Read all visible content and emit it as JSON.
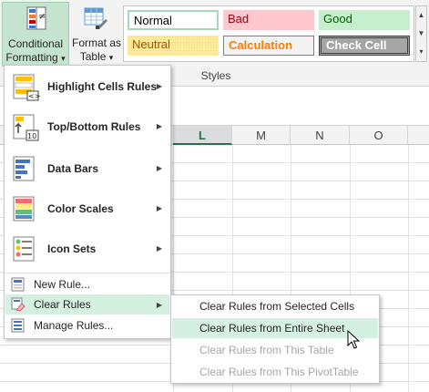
{
  "ribbon": {
    "conditional_formatting": {
      "line1": "Conditional",
      "line2": "Formatting",
      "dropdown_arrow": "▾"
    },
    "format_as_table": {
      "line1": "Format as",
      "line2": "Table",
      "dropdown_arrow": "▾"
    },
    "cell_styles": {
      "normal": "Normal",
      "bad": "Bad",
      "good": "Good",
      "neutral": "Neutral",
      "calculation": "Calculation",
      "check_cell": "Check Cell"
    },
    "styles_group_label": "Styles"
  },
  "sheet": {
    "columns": [
      "L",
      "M",
      "N",
      "O"
    ],
    "active_column": "L"
  },
  "menu": {
    "items": [
      {
        "label": "Highlight Cells Rules",
        "icon": "highlight-cells-rules-icon",
        "submenu": true
      },
      {
        "label": "Top/Bottom Rules",
        "icon": "top-bottom-rules-icon",
        "submenu": true
      },
      {
        "label": "Data Bars",
        "icon": "data-bars-icon",
        "submenu": true
      },
      {
        "label": "Color Scales",
        "icon": "color-scales-icon",
        "submenu": true
      },
      {
        "label": "Icon Sets",
        "icon": "icon-sets-icon",
        "submenu": true
      }
    ],
    "small_items": [
      {
        "label": "New Rule...",
        "icon": "new-rule-icon"
      },
      {
        "label": "Clear Rules",
        "icon": "clear-rules-icon",
        "submenu": true,
        "highlighted": true
      },
      {
        "label": "Manage Rules...",
        "icon": "manage-rules-icon"
      }
    ],
    "submenu_arrow": "▶"
  },
  "submenu": {
    "items": [
      {
        "label": "Clear Rules from Selected Cells",
        "enabled": true
      },
      {
        "label": "Clear Rules from Entire Sheet",
        "enabled": true,
        "highlighted": true
      },
      {
        "label": "Clear Rules from This Table",
        "enabled": false
      },
      {
        "label": "Clear Rules from This PivotTable",
        "enabled": false
      }
    ]
  },
  "colors": {
    "accent_green": "#217346",
    "highlight": "#d3f0e0",
    "pressed_button": "#c5e4cf"
  }
}
